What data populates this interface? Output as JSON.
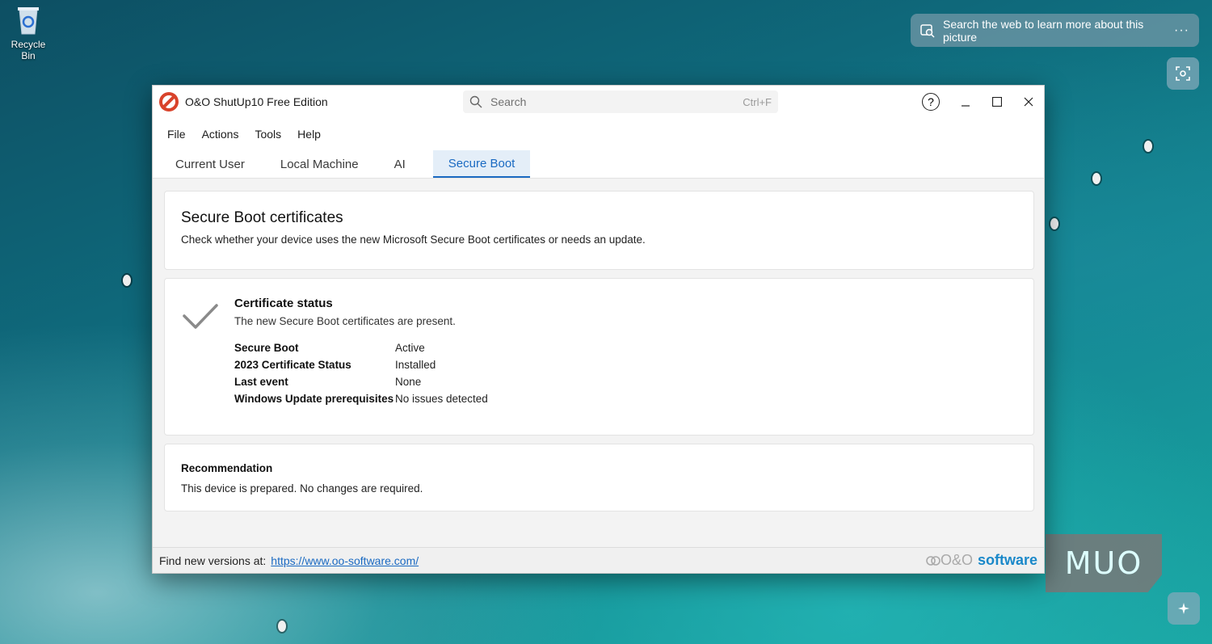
{
  "desktop": {
    "recycle_bin_label": "Recycle Bin",
    "lens_prompt": "Search the web to learn more about this picture",
    "lens_more": "···",
    "watermark": "MUO"
  },
  "window": {
    "title": "O&O ShutUp10 Free Edition",
    "search_placeholder": "Search",
    "search_shortcut": "Ctrl+F",
    "help_label": "?"
  },
  "menu": [
    "File",
    "Actions",
    "Tools",
    "Help"
  ],
  "tabs": [
    "Current User",
    "Local Machine",
    "AI",
    "Secure Boot"
  ],
  "active_tab": "Secure Boot",
  "intro": {
    "title": "Secure Boot certificates",
    "description": "Check whether your device uses the new Microsoft Secure Boot certificates or needs an update."
  },
  "status": {
    "title": "Certificate status",
    "summary": "The new Secure Boot certificates are present.",
    "rows": [
      {
        "key": "Secure Boot",
        "value": "Active"
      },
      {
        "key": "2023 Certificate Status",
        "value": "Installed"
      },
      {
        "key": "Last event",
        "value": "None"
      },
      {
        "key": "Windows Update prerequisites",
        "value": "No issues detected"
      }
    ]
  },
  "recommendation": {
    "title": "Recommendation",
    "text": "This device is prepared. No changes are required."
  },
  "footer": {
    "prefix": "Find new versions at:",
    "link": "https://www.oo-software.com/",
    "brand_prefix": "O&O",
    "brand_suffix": "software"
  },
  "colors": {
    "accent": "#1a6ac2",
    "brand_blue": "#1a88c9"
  }
}
